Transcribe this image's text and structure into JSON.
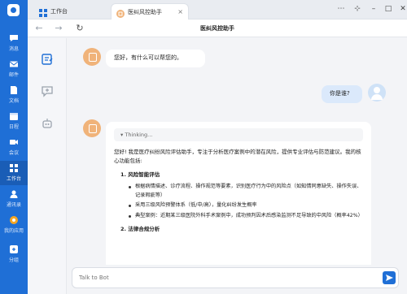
{
  "rail": {
    "items": [
      {
        "label": "消息",
        "icon": "chat-icon"
      },
      {
        "label": "邮件",
        "icon": "mail-icon"
      },
      {
        "label": "文档",
        "icon": "document-icon"
      },
      {
        "label": "日程",
        "icon": "calendar-icon"
      },
      {
        "label": "会议",
        "icon": "video-icon"
      },
      {
        "label": "工作台",
        "icon": "grid-icon"
      },
      {
        "label": "通讯录",
        "icon": "contacts-icon"
      },
      {
        "label": "我的应用",
        "icon": "apps-icon"
      },
      {
        "label": "分组",
        "icon": "group-icon"
      }
    ]
  },
  "tabs": [
    {
      "label": "工作台"
    },
    {
      "label": "医纠风控助手"
    }
  ],
  "page": {
    "title": "医纠风控助手"
  },
  "chat": {
    "bot_greeting": "您好，有什么可以帮您的。",
    "user_message": "你是谁?",
    "thinking_label": "Thinking...",
    "intro": "您好! 我是医疗纠纷风险评估助手，专注于分析医疗案例中的潜在风险，提供专业评估与防范建议。我的核心功能包括:",
    "sections": [
      {
        "title": "1. 风险智能评估",
        "bullets": [
          "根据病情描述、诊疗流程、操作规范等要素，识别医疗行为中的风险点（如知情同意缺失、操作失误、记录瑕疵等）",
          "采用三级风险预警体系（低/中/高），量化纠纷发生概率",
          "典型案例：近期某三级医院外科手术案例中，成功预判因术后感染监测不足导致的中风险（概率42%）"
        ]
      },
      {
        "title": "2. 法律合规分析",
        "bullets": []
      }
    ]
  },
  "input": {
    "placeholder": "Talk to Bot"
  },
  "colors": {
    "primary": "#1f6fd6",
    "bot_avatar": "#f0b37a"
  }
}
